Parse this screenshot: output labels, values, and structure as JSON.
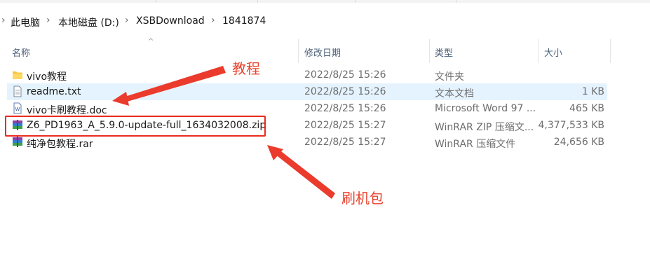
{
  "breadcrumb": [
    "此电脑",
    "本地磁盘 (D:)",
    "XSBDownload",
    "1841874"
  ],
  "columns": {
    "name": "名称",
    "date": "修改日期",
    "type": "类型",
    "size": "大小"
  },
  "files": [
    {
      "name": "vivo教程",
      "date": "2022/8/25 15:26",
      "type": "文件夹",
      "size": "",
      "icon": "folder-icon"
    },
    {
      "name": "readme.txt",
      "date": "2022/8/25 15:26",
      "type": "文本文档",
      "size": "1 KB",
      "icon": "text-file-icon"
    },
    {
      "name": "vivo卡刷教程.doc",
      "date": "2022/8/25 15:26",
      "type": "Microsoft Word 97 ...",
      "size": "465 KB",
      "icon": "word-doc-icon"
    },
    {
      "name": "Z6_PD1963_A_5.9.0-update-full_1634032008.zip",
      "date": "2022/8/25 15:27",
      "type": "WinRAR ZIP 压缩文...",
      "size": "4,377,533 KB",
      "icon": "winrar-zip-icon"
    },
    {
      "name": "纯净包教程.rar",
      "date": "2022/8/25 15:27",
      "type": "WinRAR 压缩文件",
      "size": "24,656 KB",
      "icon": "winrar-rar-icon"
    }
  ],
  "annotations": {
    "tutorial": "教程",
    "flash_package": "刷机包"
  },
  "colors": {
    "annotation": "#e8432e",
    "selection": "#e5f3ff",
    "folder": "#f4c445"
  }
}
